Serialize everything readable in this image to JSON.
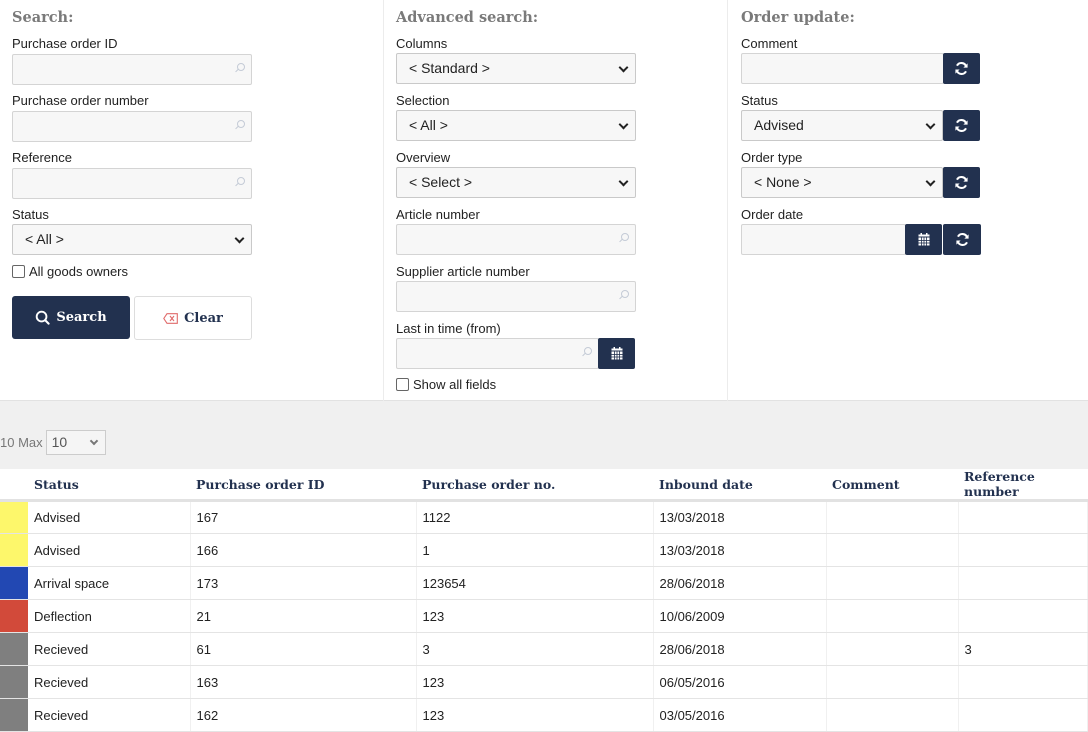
{
  "search": {
    "title": "Search:",
    "fields": {
      "purchase_order_id": {
        "label": "Purchase order ID",
        "value": ""
      },
      "purchase_order_number": {
        "label": "Purchase order number",
        "value": ""
      },
      "reference": {
        "label": "Reference",
        "value": ""
      }
    },
    "status": {
      "label": "Status",
      "value": "< All >"
    },
    "all_goods_owners": {
      "label": "All goods owners",
      "checked": false
    },
    "search_button": "Search",
    "clear_button": "Clear"
  },
  "advanced": {
    "title": "Advanced search:",
    "columns": {
      "label": "Columns",
      "value": "< Standard >"
    },
    "selection": {
      "label": "Selection",
      "value": "< All >"
    },
    "overview": {
      "label": "Overview",
      "value": "< Select >"
    },
    "article_number": {
      "label": "Article number",
      "value": ""
    },
    "supplier_article_number": {
      "label": "Supplier article number",
      "value": ""
    },
    "last_in_time": {
      "label": "Last in time (from)",
      "value": ""
    },
    "show_all_fields": {
      "label": "Show all fields",
      "checked": false
    }
  },
  "update": {
    "title": "Order update:",
    "comment": {
      "label": "Comment",
      "value": ""
    },
    "status": {
      "label": "Status",
      "value": "Advised"
    },
    "order_type": {
      "label": "Order type",
      "value": "< None >"
    },
    "order_date": {
      "label": "Order date",
      "value": ""
    }
  },
  "pager": {
    "count_label": "10 Max",
    "max_value": "10"
  },
  "table": {
    "headers": [
      "Status",
      "Purchase order ID",
      "Purchase order no.",
      "Inbound date",
      "Comment",
      "Reference number"
    ],
    "rows": [
      {
        "color": "#fdf76b",
        "status": "Advised",
        "po_id": "167",
        "po_no": "1122",
        "inbound_date": "13/03/2018",
        "comment": "",
        "reference": ""
      },
      {
        "color": "#fdf76b",
        "status": "Advised",
        "po_id": "166",
        "po_no": "1",
        "inbound_date": "13/03/2018",
        "comment": "",
        "reference": ""
      },
      {
        "color": "#2248b3",
        "status": "Arrival space",
        "po_id": "173",
        "po_no": "123654",
        "inbound_date": "28/06/2018",
        "comment": "",
        "reference": ""
      },
      {
        "color": "#d24a3a",
        "status": "Deflection",
        "po_id": "21",
        "po_no": "123",
        "inbound_date": "10/06/2009",
        "comment": "",
        "reference": ""
      },
      {
        "color": "#7f7f7f",
        "status": "Recieved",
        "po_id": "61",
        "po_no": "3",
        "inbound_date": "28/06/2018",
        "comment": "",
        "reference": "3"
      },
      {
        "color": "#7f7f7f",
        "status": "Recieved",
        "po_id": "163",
        "po_no": "123",
        "inbound_date": "06/05/2016",
        "comment": "",
        "reference": ""
      },
      {
        "color": "#7f7f7f",
        "status": "Recieved",
        "po_id": "162",
        "po_no": "123",
        "inbound_date": "03/05/2016",
        "comment": "",
        "reference": ""
      }
    ]
  },
  "colors": {
    "primary": "#22314f",
    "clear_icon": "#e06b6b"
  }
}
